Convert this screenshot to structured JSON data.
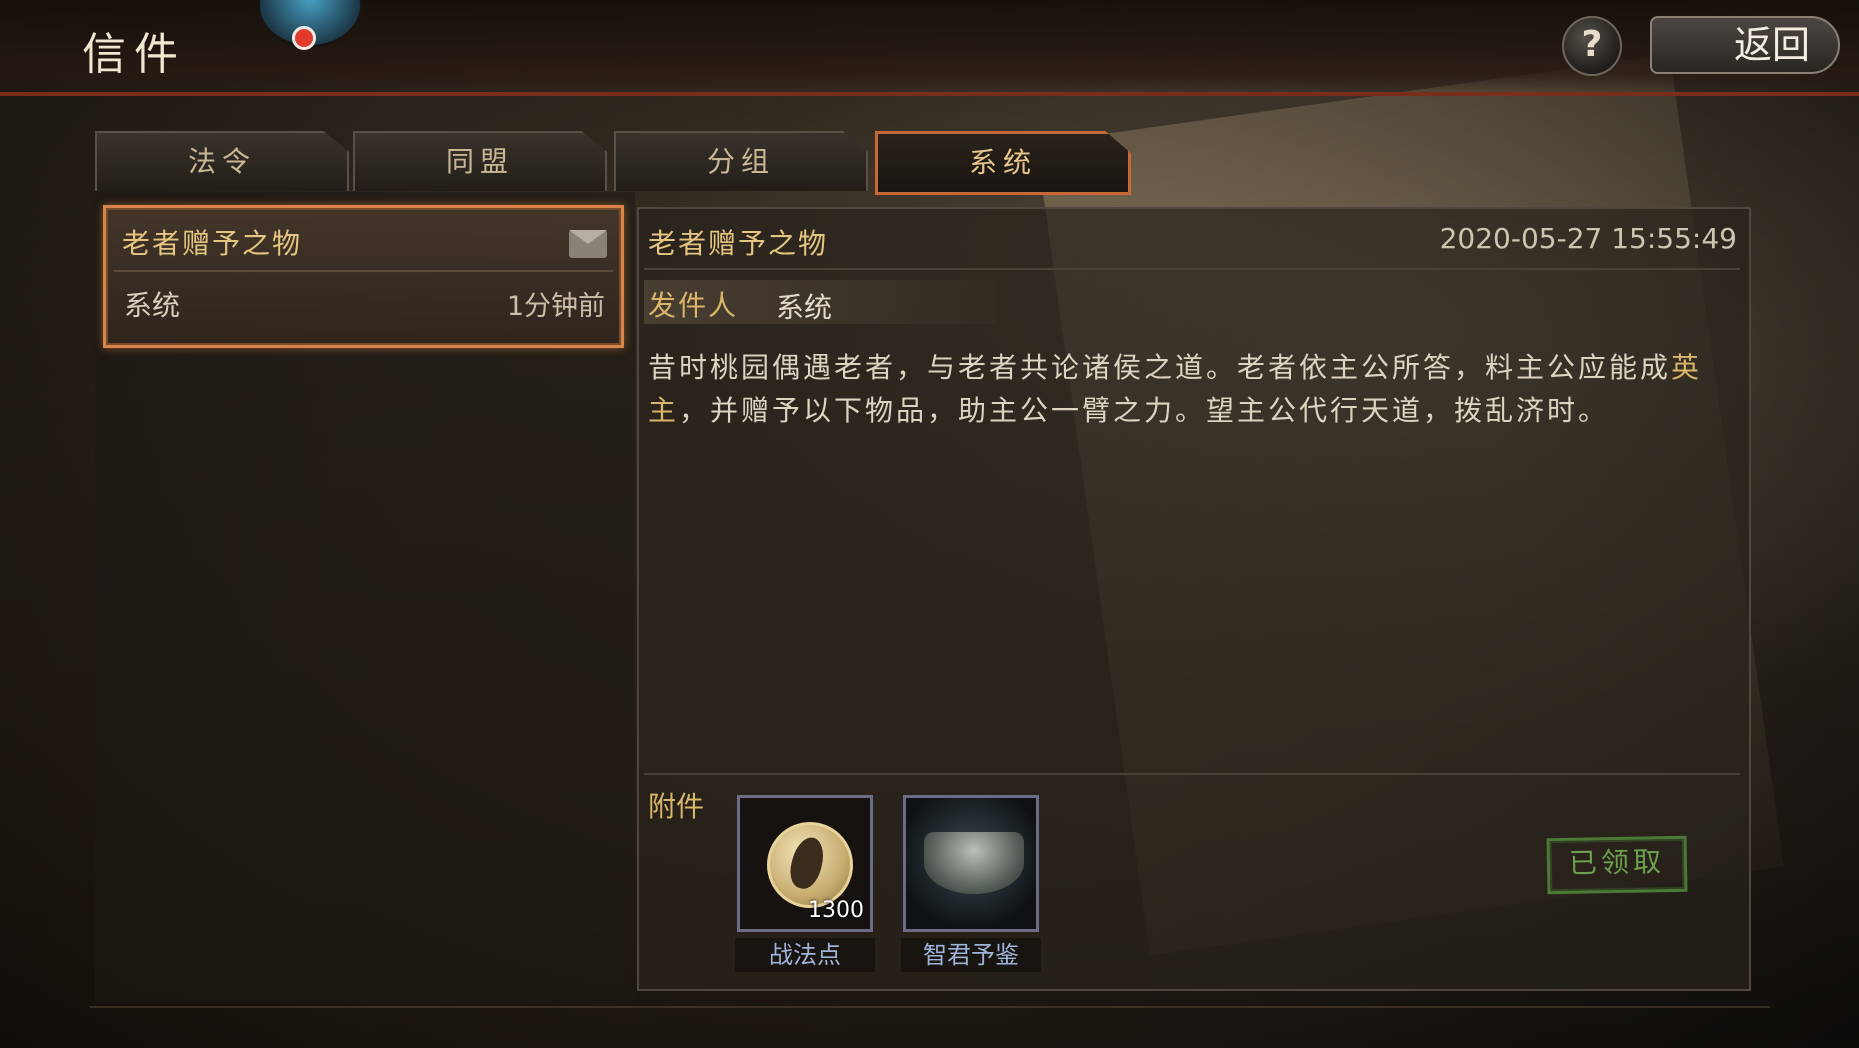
{
  "header": {
    "title": "信件",
    "help_label": "?",
    "back_label": "返回"
  },
  "tabs": [
    {
      "label": "法令",
      "active": false
    },
    {
      "label": "同盟",
      "active": false
    },
    {
      "label": "分组",
      "active": false
    },
    {
      "label": "系统",
      "active": true
    }
  ],
  "mail_list": [
    {
      "title": "老者赠予之物",
      "sender": "系统",
      "time": "1分钟前",
      "icon": "envelope-icon"
    }
  ],
  "detail": {
    "title": "老者赠予之物",
    "date": "2020-05-27 15:55:49",
    "sender_label": "发件人",
    "sender_value": "系统",
    "body_part1": "昔时桃园偶遇老者，与老者共论诸侯之道。老者依主公所答，料主公应能成",
    "body_highlight": "英主",
    "body_part2": "，并赠予以下物品，助主公一臂之力。望主公代行天道，拨乱济时。",
    "attachments_label": "附件",
    "attachments": [
      {
        "name": "战法点",
        "count": "1300",
        "icon": "tactics-point-icon"
      },
      {
        "name": "智君予鉴",
        "count": "",
        "icon": "cauldron-icon"
      }
    ],
    "claim_status": "已领取"
  },
  "colors": {
    "accent": "#c56a36",
    "gold_text": "#d9b66a",
    "claimed_green": "#4a7a36"
  }
}
